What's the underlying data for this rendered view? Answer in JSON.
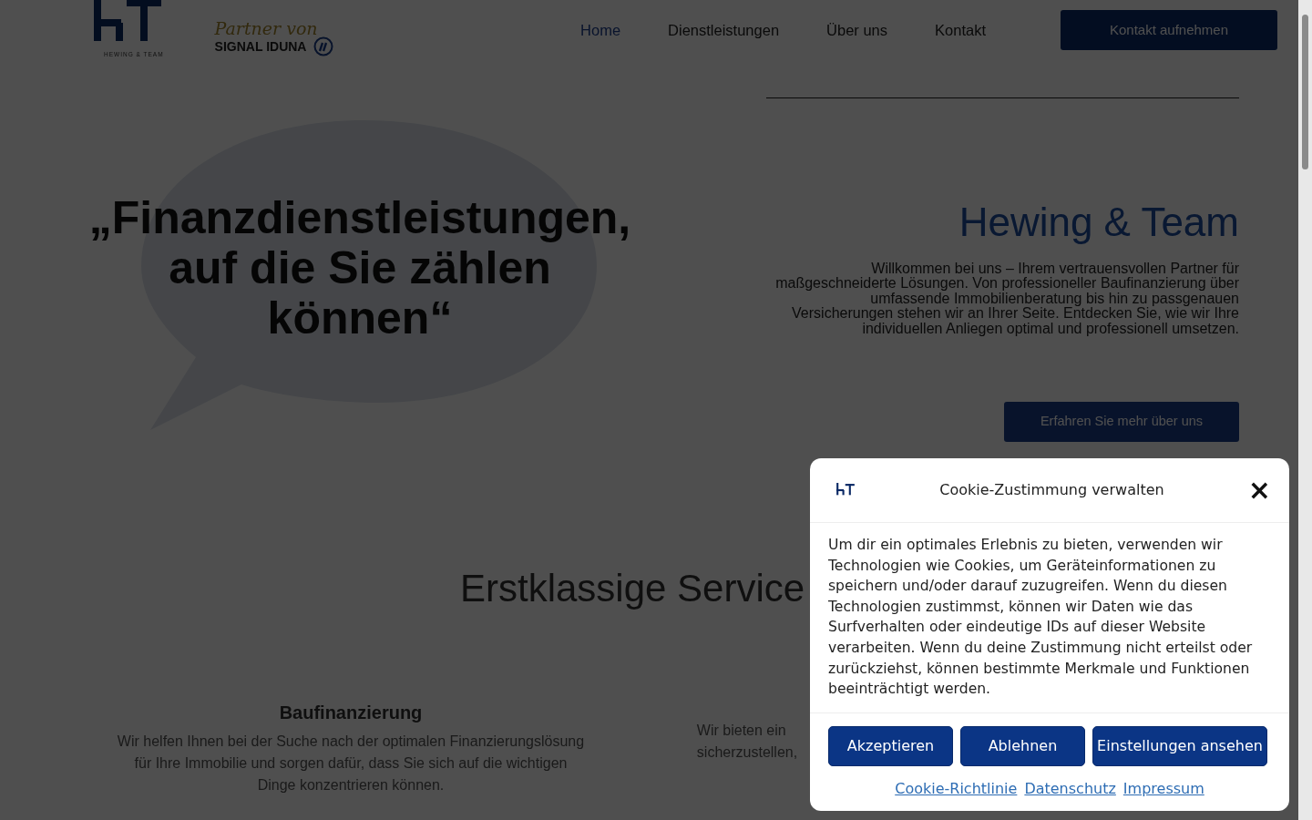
{
  "header": {
    "logo_caption": "HEWING & TEAM",
    "partner": {
      "script": "Partner von",
      "brand": "SIGNAL IDUNA"
    },
    "nav": [
      {
        "label": "Home",
        "selected": true
      },
      {
        "label": "Dienstleistungen",
        "selected": false
      },
      {
        "label": "Über uns",
        "selected": false
      },
      {
        "label": "Kontakt",
        "selected": false
      }
    ],
    "cta": "Kontakt aufnehmen"
  },
  "hero": {
    "quote": "„Finanzdienstleistungen,\nauf die Sie zählen\nkönnen“",
    "title": "Hewing & Team",
    "text": "Willkommen bei uns – Ihrem vertrauensvollen Partner für maßgeschneiderte Lösungen. Von professioneller Baufinanzierung über umfassende Immobilienberatung bis hin zu passgenauen Versicherungen stehen wir an Ihrer Seite. Entdecken Sie, wie wir Ihre individuellen Anliegen optimal und professionell umsetzen.",
    "button": "Erfahren Sie mehr über uns"
  },
  "services": {
    "heading": "Erstklassige Service",
    "items": [
      {
        "title": "Baufinanzierung",
        "text": "Wir helfen Ihnen bei der Suche nach der optimalen Finanzierungslösung für Ihre Immobilie und sorgen dafür, dass Sie sich auf die wichtigen Dinge konzentrieren können."
      },
      {
        "text": "Wir bieten ein\nsicherzustellen,"
      }
    ]
  },
  "cookie_dialog": {
    "title": "Cookie-Zustimmung verwalten",
    "close": "×",
    "text": "Um dir ein optimales Erlebnis zu bieten, verwenden wir Technologien wie Cookies, um Geräteinformationen zu speichern und/oder darauf zuzugreifen. Wenn du diesen Technologien zustimmst, können wir Daten wie das Surfverhalten oder eindeutige IDs auf dieser Website verarbeiten. Wenn du deine Zustimmung nicht erteilst oder zurückziehst, können bestimmte Merkmale und Funktionen beeinträchtigt werden.",
    "buttons": [
      "Akzeptieren",
      "Ablehnen",
      "Einstellungen ansehen"
    ],
    "links": [
      "Cookie-Richtlinie",
      "Datenschutz",
      "Impressum"
    ]
  }
}
